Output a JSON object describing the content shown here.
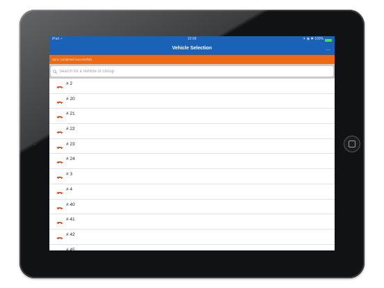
{
  "status_bar": {
    "left": "iPad ✓",
    "time": "22:08",
    "right": "✈ ◉ ✱ 100%"
  },
  "nav_bar": {
    "title": "Vehicle Selection",
    "more_label": "…"
  },
  "colors": {
    "nav_blue": "#1a62b8",
    "banner_orange": "#ec6a16",
    "car_orange": "#e0571e"
  },
  "sync_banner": {
    "message": "Sync completed successfully"
  },
  "search": {
    "placeholder": "Search for a Vehicle or Group",
    "value": "",
    "icon": "search-icon"
  },
  "vehicles": [
    {
      "label": "# 2",
      "icon": "car-icon"
    },
    {
      "label": "# 20",
      "icon": "car-icon"
    },
    {
      "label": "# 21",
      "icon": "car-icon"
    },
    {
      "label": "# 22",
      "icon": "car-icon"
    },
    {
      "label": "# 23",
      "icon": "car-icon"
    },
    {
      "label": "# 24",
      "icon": "car-icon"
    },
    {
      "label": "# 3",
      "icon": "car-icon"
    },
    {
      "label": "# 4",
      "icon": "car-icon"
    },
    {
      "label": "# 40",
      "icon": "car-icon"
    },
    {
      "label": "# 41",
      "icon": "car-icon"
    },
    {
      "label": "# 42",
      "icon": "car-icon"
    },
    {
      "label": "# 45",
      "icon": "car-icon"
    }
  ]
}
